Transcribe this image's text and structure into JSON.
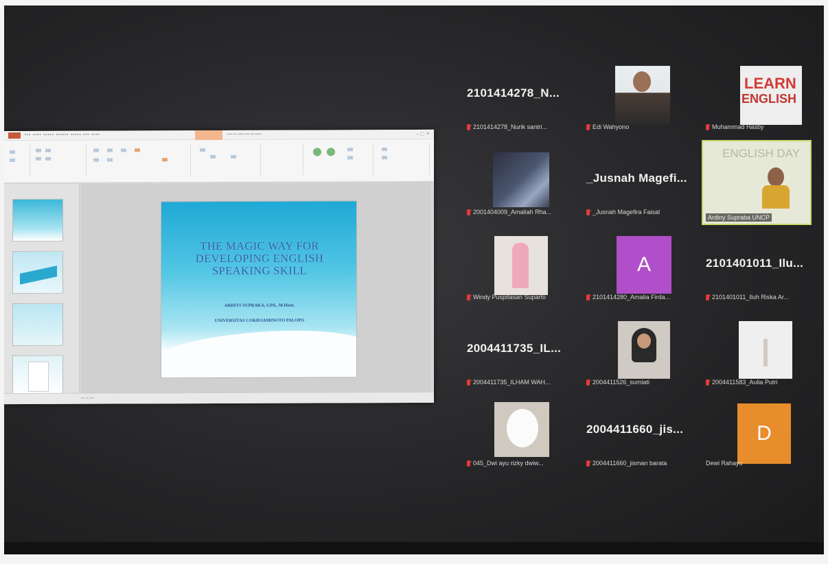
{
  "ppt": {
    "slide_title": "THE MAGIC WAY FOR DEVELOPING ENGLISH SPEAKING SKILL",
    "author": "ARDIYS SUPRAKA, S.Pd., M.Hum.",
    "university": "UNIVERSITAS COKROAMINOTO PALOPO"
  },
  "participants": [
    {
      "big_name": "2101414278_N...",
      "label": "2101414278_Nurik santri...",
      "muted": true
    },
    {
      "label": "Edi Wahyono",
      "muted": true
    },
    {
      "label": "Muhammad Hasby",
      "muted": true,
      "banner_top": "LEARN",
      "banner_bottom": "ENGLISH"
    },
    {
      "label": "2001404009_Amaliah Rha...",
      "muted": true
    },
    {
      "big_name": "_Jusnah Magefi...",
      "label": "_Jusnah Magefira Faisal",
      "muted": true
    },
    {
      "label": "Ardiny Supraba UNCP",
      "muted": false,
      "banner": "ENGLISH DAY"
    },
    {
      "label": "Windy Puspitasari Suparto",
      "muted": true
    },
    {
      "avatar": "A",
      "label": "2101414280_Amalia Firda...",
      "muted": true
    },
    {
      "big_name": "2101401011_Ilu...",
      "label": "2101401011_Iluh Riska Ar...",
      "muted": true
    },
    {
      "big_name": "2004411735_IL...",
      "label": "2004411735_ILHAM WAH...",
      "muted": true
    },
    {
      "label": "2004411526_sumiati",
      "muted": true
    },
    {
      "label": "2004411583_Aulia Putri",
      "muted": true
    },
    {
      "label": "045_Dwi ayu rizky dwiw...",
      "muted": true
    },
    {
      "big_name": "2004411660_jis...",
      "label": "2004411660_jisman barata",
      "muted": true
    },
    {
      "avatar": "D",
      "label": "Dewi Rahayu",
      "muted": false
    }
  ],
  "colors": {
    "avatar_a": "#b04fc9",
    "avatar_d": "#e88d2c",
    "mic_muted": "#e23a3a",
    "active_speaker_border": "#c4d86a"
  }
}
